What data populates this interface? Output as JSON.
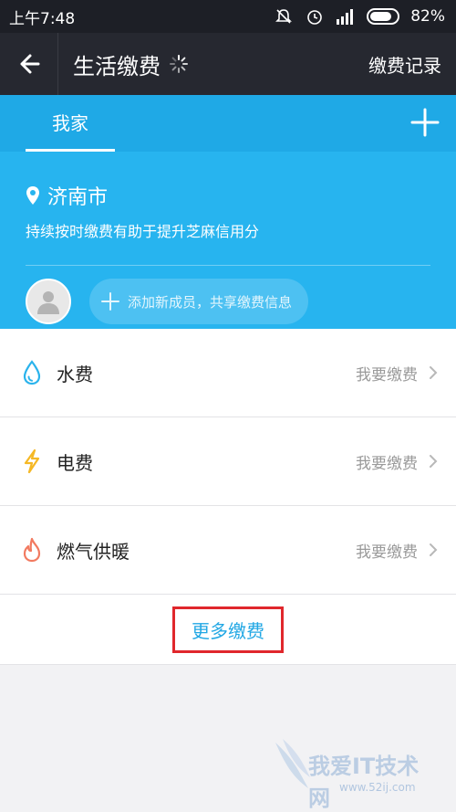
{
  "status_bar": {
    "time": "上午7:48",
    "battery_percent": "82%",
    "battery_level": 0.82
  },
  "nav": {
    "title": "生活缴费",
    "record_label": "缴费记录"
  },
  "tabs": {
    "active_label": "我家"
  },
  "location": {
    "city": "济南市",
    "subtitle": "持续按时缴费有助于提升芝麻信用分"
  },
  "member": {
    "add_label": "添加新成员，共享缴费信息"
  },
  "items": [
    {
      "label": "水费",
      "action": "我要缴费",
      "icon": "water-drop-icon",
      "color": "#2ab3ec"
    },
    {
      "label": "电费",
      "action": "我要缴费",
      "icon": "lightning-icon",
      "color": "#f5b825"
    },
    {
      "label": "燃气供暖",
      "action": "我要缴费",
      "icon": "flame-icon",
      "color": "#f27a60"
    }
  ],
  "more": {
    "label": "更多缴费"
  },
  "watermark": {
    "text": "我爱IT技术网",
    "url": "www.52ij.com"
  },
  "colors": {
    "accent_blue": "#27b4ef",
    "nav_dark": "#262830",
    "highlight_red": "#e0272c"
  }
}
